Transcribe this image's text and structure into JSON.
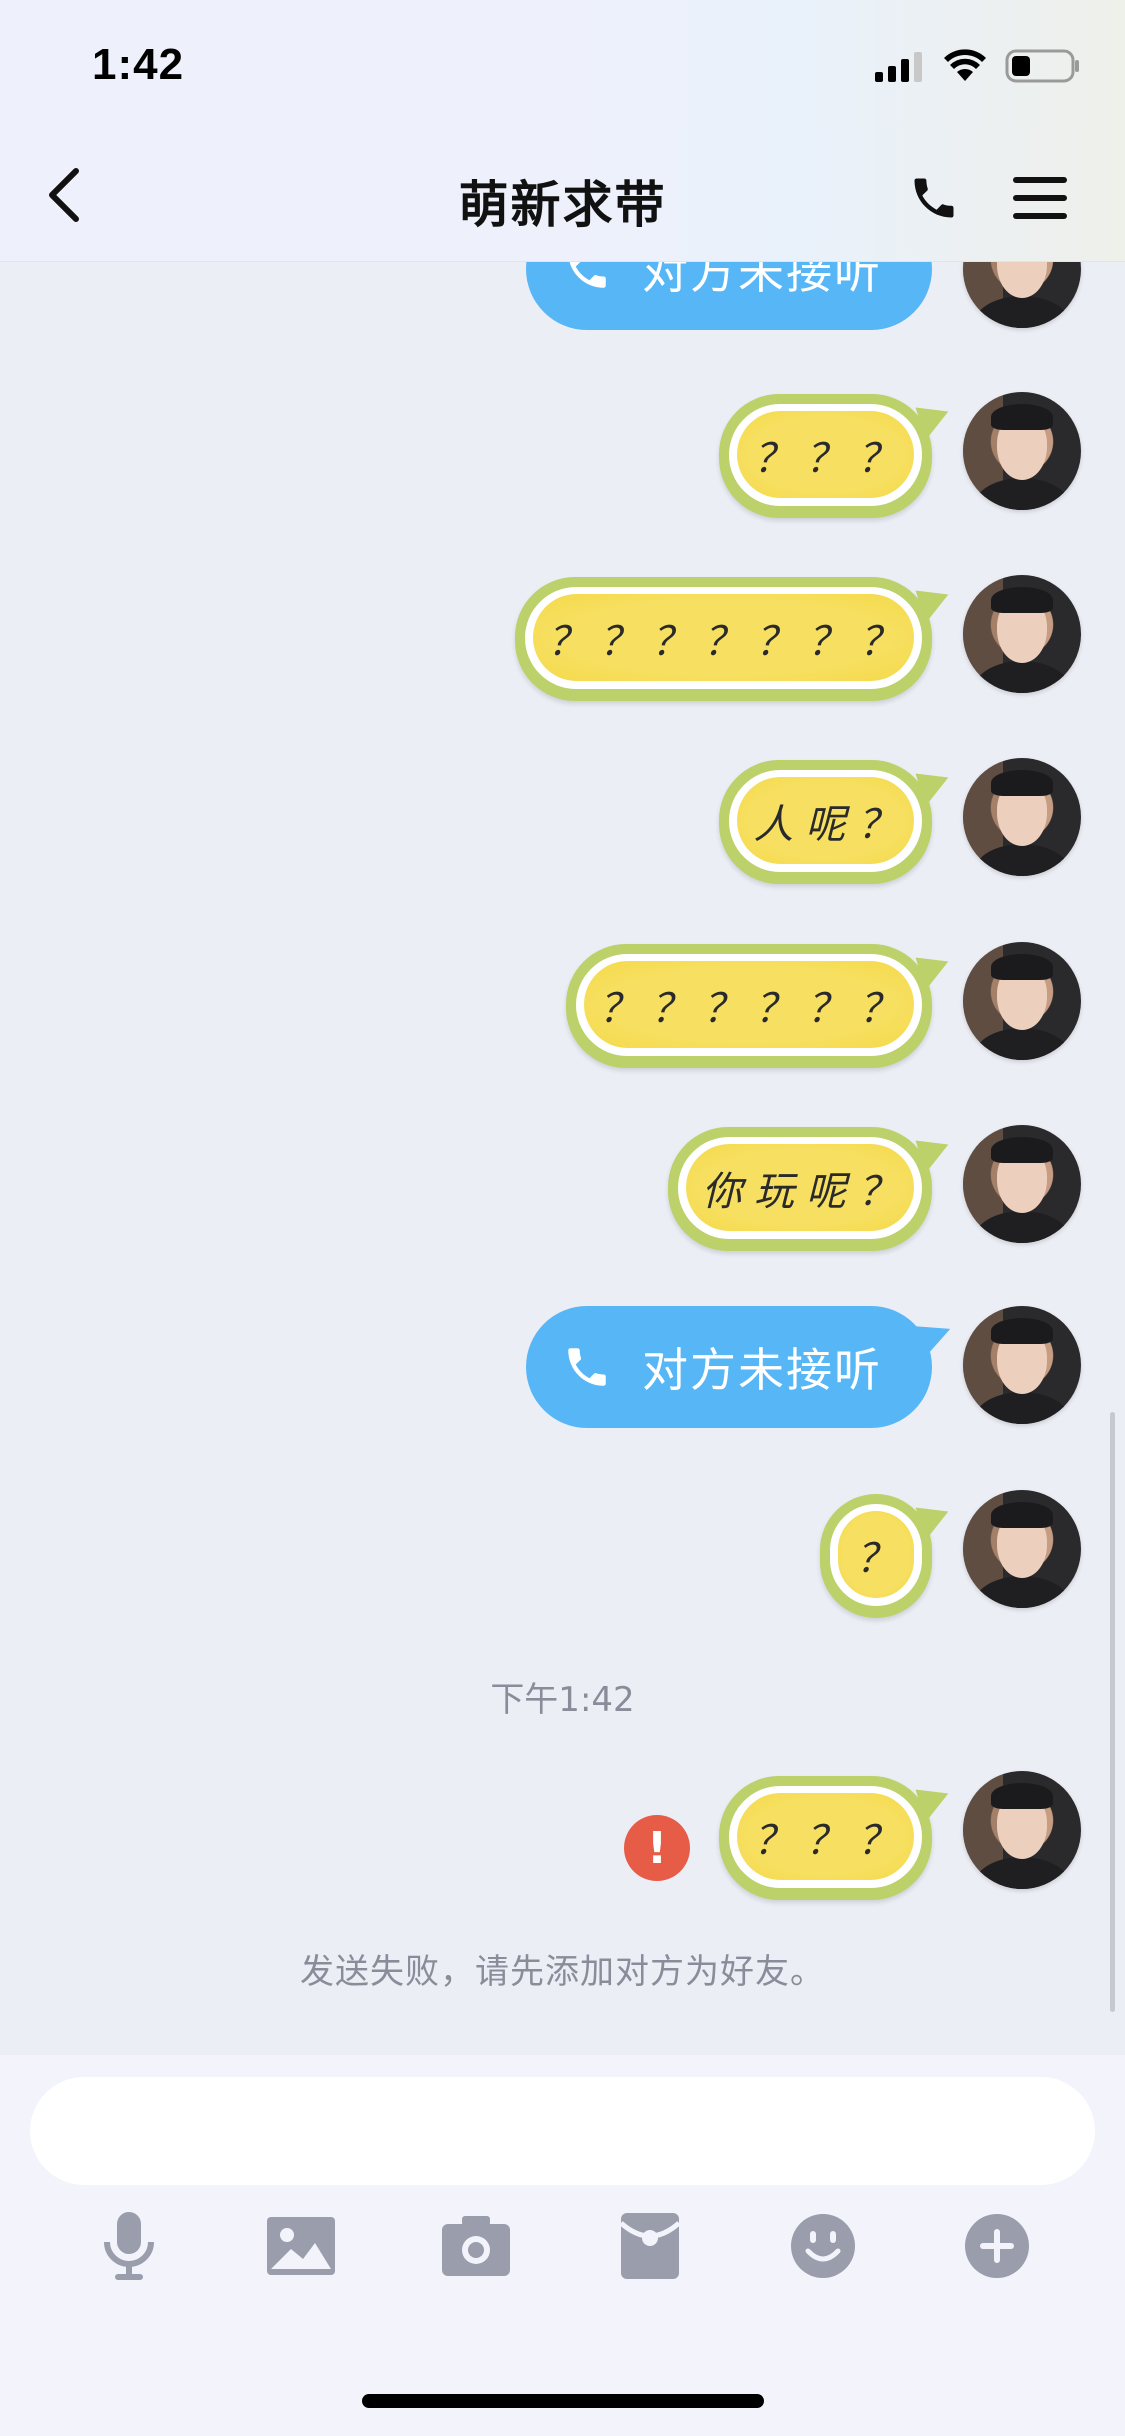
{
  "status_bar": {
    "time": "1:42"
  },
  "nav": {
    "title": "萌新求带"
  },
  "messages": [
    {
      "type": "call",
      "text": "对方未接听"
    },
    {
      "type": "text",
      "text": "？？？"
    },
    {
      "type": "text",
      "text": "？？？？？？？"
    },
    {
      "type": "text",
      "text": "人呢？"
    },
    {
      "type": "text",
      "text": "？？？？？？"
    },
    {
      "type": "text",
      "text": "你玩呢？"
    },
    {
      "type": "call",
      "text": "对方未接听"
    },
    {
      "type": "text",
      "text": "？"
    },
    {
      "type": "timestamp",
      "text": "下午1:42"
    },
    {
      "type": "text",
      "text": "？？？",
      "status": "failed"
    },
    {
      "type": "system",
      "text": "发送失败，请先添加对方为好友。"
    }
  ],
  "failed_indicator": "!",
  "composer": {
    "input_value": "",
    "input_placeholder": ""
  },
  "toolbar_icons": [
    "microphone-icon",
    "image-icon",
    "camera-icon",
    "red-packet-icon",
    "emoji-icon",
    "plus-icon"
  ],
  "colors": {
    "call_bubble": "#56b6f6",
    "lemon_bubble": "#f7e061",
    "error": "#e65c46",
    "icon_gray": "#9a9dab"
  }
}
